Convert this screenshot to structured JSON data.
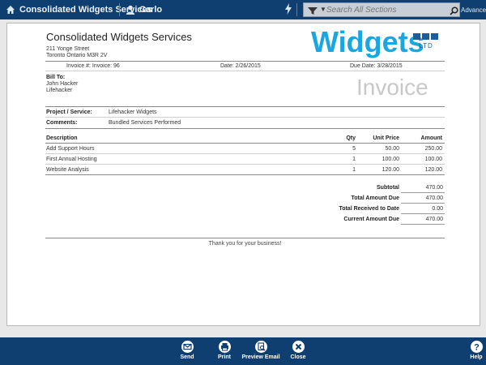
{
  "topbar": {
    "company": "Consolidated Widgets Services",
    "user": "Carlo",
    "search_placeholder": "Search All Sections",
    "advanced_label": "Advanced"
  },
  "invoice": {
    "company_name": "Consolidated Widgets Services",
    "address_line1": "211 Yonge Street",
    "address_line2": "Toronto Ontario M3R 2V",
    "logo_text": "Widgets",
    "logo_ltd": "LTD",
    "invoice_number": "Invoice #: Invoice: 96",
    "date": "Date: 2/26/2015",
    "due_date": "Due Date: 3/28/2015",
    "bill_to_label": "Bill To:",
    "bill_to_name": "John Hacker",
    "bill_to_company": "Lifehacker",
    "title": "Invoice",
    "project_label": "Project / Service:",
    "project_value": "Lifehacker Widgets",
    "comments_label": "Comments:",
    "comments_value": "Bundled Services Performed",
    "columns": {
      "description": "Description",
      "qty": "Qty",
      "unit_price": "Unit Price",
      "amount": "Amount"
    },
    "items": [
      {
        "description": "Add Support Hours",
        "qty": "5",
        "unit_price": "50.00",
        "amount": "250.00"
      },
      {
        "description": "First Annual Hosting",
        "qty": "1",
        "unit_price": "100.00",
        "amount": "100.00"
      },
      {
        "description": "Website Analysis",
        "qty": "1",
        "unit_price": "120.00",
        "amount": "120.00"
      }
    ],
    "totals": [
      {
        "label": "Subtotal",
        "value": "470.00"
      },
      {
        "label": "Total Amount Due",
        "value": "470.00"
      },
      {
        "label": "Total Received to Date",
        "value": "0.00"
      },
      {
        "label": "Current Amount Due",
        "value": "470.00"
      }
    ],
    "thanks": "Thank you for your business!"
  },
  "toolbar": {
    "send_label": "Send",
    "print_label": "Print",
    "preview_email_label": "Preview Email",
    "close_label": "Close",
    "help_label": "Help"
  },
  "colors": {
    "bar": "#0f3f70",
    "logo_blue": "#1aa6e0",
    "logo_dark": "#1d5e9a"
  }
}
